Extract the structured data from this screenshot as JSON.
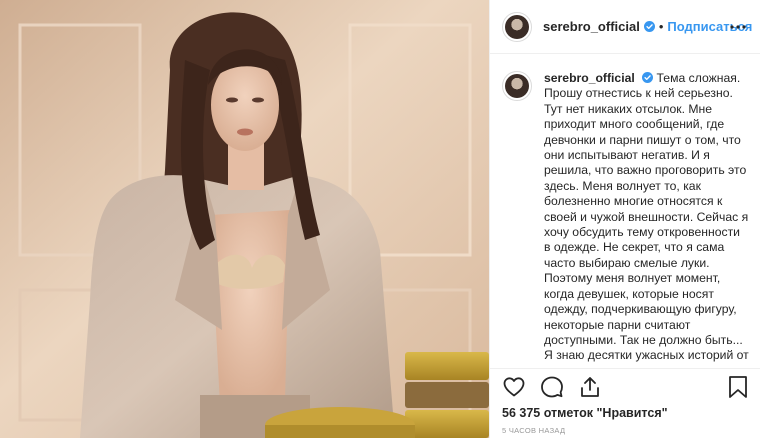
{
  "post": {
    "header": {
      "username": "serebro_official",
      "separator": "•",
      "follow_label": "Подписаться"
    },
    "caption": {
      "username": "serebro_official",
      "text": "Тема сложная. Прошу отнестись к ней серьезно. Тут нет никаких отсылок. Мне приходит много сообщений, где девчонки и парни пишут о том, что они испытывают негатив. И я решила, что важно проговорить это здесь. Меня волнует то, как болезненно многие относятся к своей и чужой внешности. Сейчас я хочу обсудить тему откровенности в одежде. Не секрет, что я сама часто выбираю смелые луки. Поэтому меня волнует момент, когда девушек, которые носят одежду, подчеркивающую фигуру, некоторые парни считают доступными. Так не должно быть... Я знаю десятки ужасных историй от"
    },
    "likes": "56 375 отметок \"Нравится\"",
    "timestamp": "5 часов назад"
  },
  "icons": {
    "verified": "verified-badge-icon",
    "more": "more-options-icon",
    "like": "heart-icon",
    "comment": "comment-icon",
    "share": "share-icon",
    "save": "bookmark-icon"
  },
  "colors": {
    "accent": "#3897f0",
    "text": "#262626",
    "muted": "#999999",
    "border": "#efefef"
  }
}
